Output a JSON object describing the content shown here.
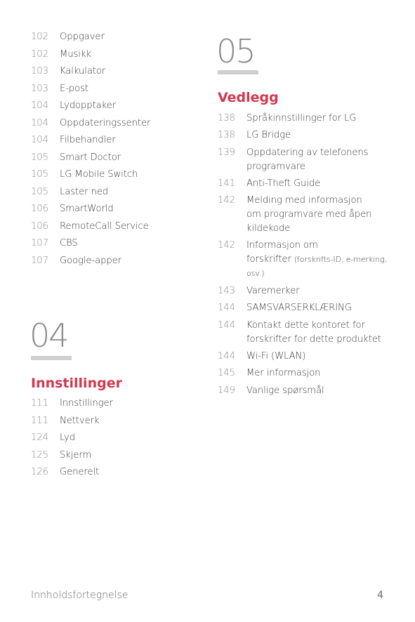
{
  "left_column": {
    "entries": [
      {
        "page": "102",
        "title": "Oppgaver"
      },
      {
        "page": "102",
        "title": "Musikk"
      },
      {
        "page": "103",
        "title": "Kalkulator"
      },
      {
        "page": "103",
        "title": "E-post"
      },
      {
        "page": "104",
        "title": "Lydopptaker"
      },
      {
        "page": "104",
        "title": "Oppdateringssenter"
      },
      {
        "page": "104",
        "title": "Filbehandler"
      },
      {
        "page": "105",
        "title": "Smart Doctor"
      },
      {
        "page": "105",
        "title": "LG Mobile Switch"
      },
      {
        "page": "105",
        "title": "Laster ned"
      },
      {
        "page": "106",
        "title": "SmartWorld"
      },
      {
        "page": "106",
        "title": "RemoteCall Service"
      },
      {
        "page": "107",
        "title": "CBS"
      },
      {
        "page": "107",
        "title": "Google-apper"
      }
    ],
    "chapter": {
      "number": "04",
      "title": "Innstillinger",
      "entries": [
        {
          "page": "111",
          "title": "Innstillinger"
        },
        {
          "page": "111",
          "title": "Nettverk"
        },
        {
          "page": "124",
          "title": "Lyd"
        },
        {
          "page": "125",
          "title": "Skjerm"
        },
        {
          "page": "126",
          "title": "Generelt"
        }
      ]
    }
  },
  "right_column": {
    "chapter": {
      "number": "05",
      "title": "Vedlegg",
      "entries": [
        {
          "page": "138",
          "title": "Språkinnstillinger for LG"
        },
        {
          "page": "138",
          "title": "LG Bridge"
        },
        {
          "page": "139",
          "line1": "Oppdatering av telefonens",
          "line2": "programvare"
        },
        {
          "page": "141",
          "title": "Anti-Theft Guide"
        },
        {
          "page": "142",
          "line1": "Melding med informasjon",
          "line2": "om programvare med åpen",
          "line3": "kildekode"
        },
        {
          "page": "142",
          "line1": "Informasjon om",
          "line2": "forskrifter",
          "line2_small": "(forskrifts-ID, e-merking,",
          "line3_small": "osv.)"
        },
        {
          "page": "143",
          "title": "Varemerker"
        },
        {
          "page": "144",
          "title": "SAMSVARSERKLÆRING"
        },
        {
          "page": "144",
          "line1": "Kontakt dette kontoret for",
          "line2": "forskrifter for dette produktet"
        },
        {
          "page": "144",
          "title": "Wi-Fi (WLAN)"
        },
        {
          "page": "145",
          "title": "Mer informasjon"
        },
        {
          "page": "149",
          "title": "Vanlige spørsmål"
        }
      ]
    }
  },
  "footer": {
    "title": "Innholdsfortegnelse",
    "page_number": "4"
  },
  "colors": {
    "section_title": "#d2384f",
    "chapter_number": "#8c8c8c",
    "chapter_bar": "#cfcfcf"
  }
}
